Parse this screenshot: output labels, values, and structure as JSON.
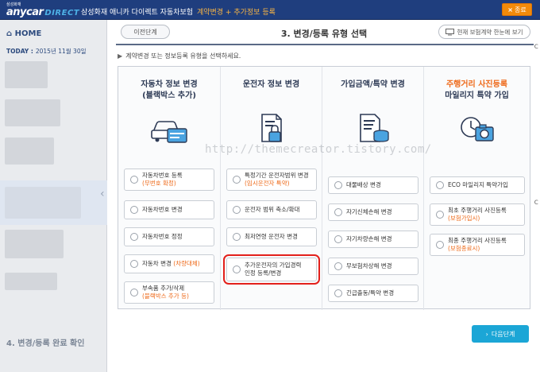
{
  "header": {
    "logo_small": "삼성화재",
    "logo": "anycar",
    "logo_direct": "DIRECT",
    "brand": "삼성화재 애니카 다이렉트 자동차보험",
    "brand_sub": "계약변경 + 추가정보 등록",
    "close_x": "×",
    "close_label": "종료"
  },
  "sidebar": {
    "home": "HOME",
    "today_label": "TODAY :",
    "today_date": "2015년 11월 30일",
    "step4": "4. 변경/등록 완료 확인"
  },
  "main": {
    "prev_button": "이전단계",
    "title": "3. 변경/등록 유형 선택",
    "compare_button": "현재 보험계약 한눈에 보기",
    "instruction": "계약변경 또는 정보등록 유형을 선택하세요.",
    "next_button": "다음단계"
  },
  "columns": [
    {
      "title_line1": "자동차 정보 변경",
      "title_line2": "(블랙박스 추가)",
      "icon": "car-card-icon",
      "options": [
        {
          "label": "자동차번호 등록",
          "sub": "(무번호 확정)"
        },
        {
          "label": "자동차번호 변경"
        },
        {
          "label": "자동차번호 정정"
        },
        {
          "label": "자동차 변경",
          "sub_inline": "(차량대체)"
        },
        {
          "label": "부속품 추가/삭제",
          "sub": "(블랙박스 추가 등)"
        }
      ]
    },
    {
      "title_line1": "운전자 정보 변경",
      "icon": "document-lock-icon",
      "options": [
        {
          "label": "특정기간 운전자범위 변경",
          "sub": "(임시운전자 특약)"
        },
        {
          "label": "운전자 범위 축소/확대"
        },
        {
          "label": "최저연령 운전자 변경"
        },
        {
          "label": "추가운전자의 가입경력",
          "label2": "인정 등록/변경"
        }
      ]
    },
    {
      "title_line1": "가입금액/특약 변경",
      "icon": "document-coins-icon",
      "options": [
        {
          "label": "대물배상 변경"
        },
        {
          "label": "자기신체손해 변경"
        },
        {
          "label": "자기차량손해 변경"
        },
        {
          "label": "무보험차상해 변경"
        },
        {
          "label": "긴급출동/특약 변경"
        }
      ]
    },
    {
      "title_line1": "주행거리 사진등록",
      "title_line2": "마일리지 특약 가입",
      "icon": "camera-clock-icon",
      "options": [
        {
          "label": "ECO 마일리지 특약가입"
        },
        {
          "label": "최초 주행거리 사진등록",
          "sub": "(보험가입시)"
        },
        {
          "label": "최종 주행거리 사진등록",
          "sub": "(보험종료시)"
        }
      ]
    }
  ],
  "watermark": "http://themecreator.tistory.com/",
  "colors": {
    "header": "#1f3e7e",
    "accent": "#ee6a1a",
    "next": "#1ba6d6",
    "highlight": "#e3201b"
  }
}
